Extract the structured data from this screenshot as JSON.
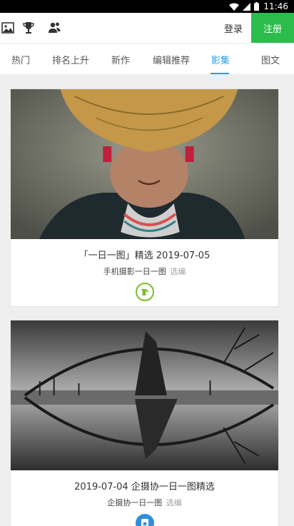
{
  "status_bar": {
    "time": "11:46"
  },
  "header": {
    "login_label": "登录",
    "register_label": "注册"
  },
  "tabs": [
    {
      "label": "热门",
      "active": false
    },
    {
      "label": "排名上升",
      "active": false
    },
    {
      "label": "新作",
      "active": false
    },
    {
      "label": "编辑推荐",
      "active": false
    },
    {
      "label": "影集",
      "active": true
    },
    {
      "label": "图文",
      "active": false
    }
  ],
  "cards": [
    {
      "title": "「一日一图」精选 2019-07-05",
      "author": "手机摄影一日一图",
      "tag": "选编",
      "badge_color": "#7bbf2a"
    },
    {
      "title": "2019-07-04 企摄协一日一图精选",
      "author": "企摄协一日一图",
      "tag": "选编",
      "badge_color": "#2f8fd8"
    }
  ],
  "colors": {
    "accent": "#24a0e6",
    "register_bg": "#2bbd4c"
  }
}
